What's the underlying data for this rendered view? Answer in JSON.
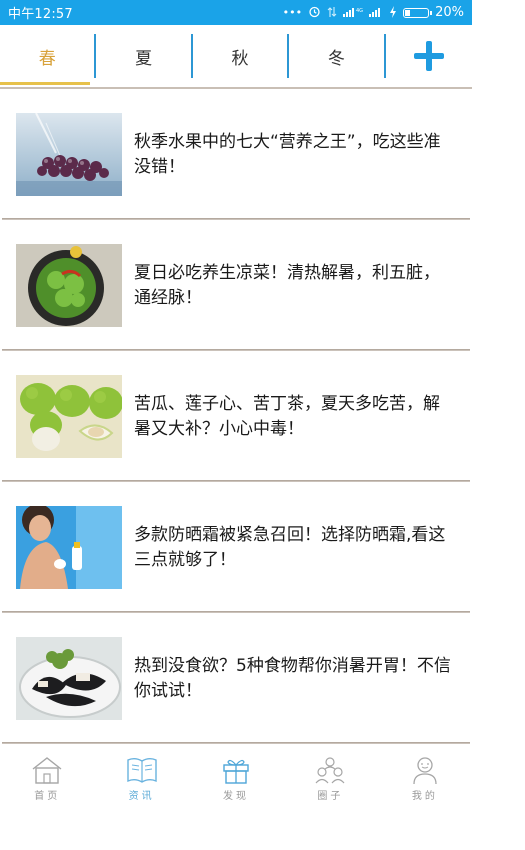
{
  "status_bar": {
    "time": "中午12:57",
    "icons": [
      "more-dots-icon",
      "alarm-icon",
      "data-arrows-icon",
      "signal-4g-icon",
      "signal-icon",
      "charging-icon"
    ],
    "battery": "20%",
    "battery_level": 0.2,
    "bg_color": "#1aa3e8"
  },
  "tabs": [
    {
      "label": "春",
      "active": true
    },
    {
      "label": "夏",
      "active": false
    },
    {
      "label": "秋",
      "active": false
    },
    {
      "label": "冬",
      "active": false
    }
  ],
  "add_button_icon": "plus-icon",
  "accent_color": "#2c97d4",
  "active_tab_color": "#d8a23a",
  "news": [
    {
      "title": " 秋季水果中的七大“营养之王”，吃这些准没错！",
      "image": "grapes-photo"
    },
    {
      "title": "夏日必吃养生凉菜！清热解暑，利五脏，通经脉！",
      "image": "green-salad-photo"
    },
    {
      "title": "苦瓜、莲子心、苦丁茶，夏天多吃苦，解暑又大补？小心中毒！",
      "image": "green-fruit-photo"
    },
    {
      "title": "多款防晒霜被紧急召回！选择防晒霜,看这三点就够了！",
      "image": "sunscreen-woman-photo"
    },
    {
      "title": "热到没食欲？5种食物帮你消暑开胃！不信你试试！",
      "image": "dark-dish-photo"
    }
  ],
  "bottom_nav": [
    {
      "label": "首页",
      "icon": "home-icon",
      "active": false
    },
    {
      "label": "资讯",
      "icon": "book-icon",
      "active": true
    },
    {
      "label": "发现",
      "icon": "gift-icon",
      "active": false
    },
    {
      "label": "圈子",
      "icon": "group-icon",
      "active": false
    },
    {
      "label": "我的",
      "icon": "profile-icon",
      "active": false
    }
  ]
}
